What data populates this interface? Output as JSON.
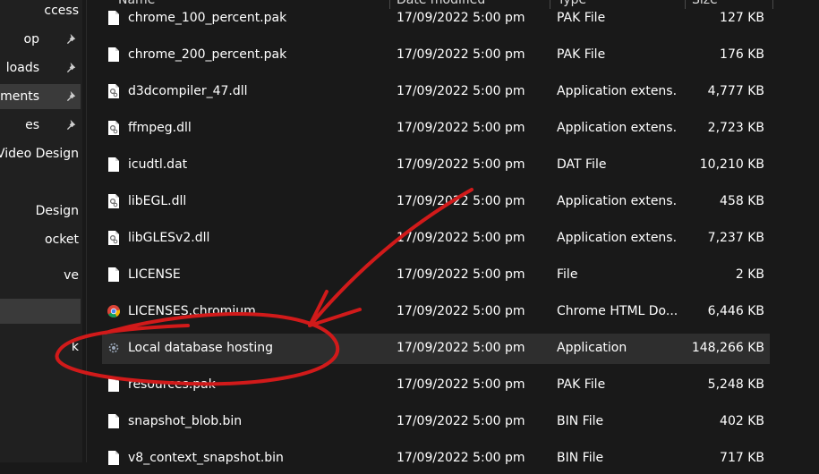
{
  "sidebar": {
    "items": [
      {
        "label": "ccess",
        "pinned": false,
        "selected": false
      },
      {
        "label": "op",
        "pinned": true,
        "selected": false
      },
      {
        "label": "loads",
        "pinned": true,
        "selected": false
      },
      {
        "label": "ments",
        "pinned": true,
        "selected": true
      },
      {
        "label": "es",
        "pinned": true,
        "selected": false
      },
      {
        "label": "Video Design",
        "pinned": false,
        "selected": false
      },
      {
        "label": "Design",
        "pinned": false,
        "selected": false
      },
      {
        "label": "ocket",
        "pinned": false,
        "selected": false
      },
      {
        "label": "ve",
        "pinned": false,
        "selected": false
      },
      {
        "label": "",
        "pinned": false,
        "selected": true
      },
      {
        "label": "k",
        "pinned": false,
        "selected": false
      }
    ]
  },
  "columns": {
    "name": "Name",
    "date": "Date modified",
    "type": "Type",
    "size": "Size"
  },
  "files": [
    {
      "name": "chrome_100_percent.pak",
      "date": "17/09/2022 5:00 pm",
      "type": "PAK File",
      "size": "127 KB",
      "icon": "file-icon"
    },
    {
      "name": "chrome_200_percent.pak",
      "date": "17/09/2022 5:00 pm",
      "type": "PAK File",
      "size": "176 KB",
      "icon": "file-icon"
    },
    {
      "name": "d3dcompiler_47.dll",
      "date": "17/09/2022 5:00 pm",
      "type": "Application extens...",
      "size": "4,777 KB",
      "icon": "dll-icon"
    },
    {
      "name": "ffmpeg.dll",
      "date": "17/09/2022 5:00 pm",
      "type": "Application extens...",
      "size": "2,723 KB",
      "icon": "dll-icon"
    },
    {
      "name": "icudtl.dat",
      "date": "17/09/2022 5:00 pm",
      "type": "DAT File",
      "size": "10,210 KB",
      "icon": "file-icon"
    },
    {
      "name": "libEGL.dll",
      "date": "17/09/2022 5:00 pm",
      "type": "Application extens...",
      "size": "458 KB",
      "icon": "dll-icon"
    },
    {
      "name": "libGLESv2.dll",
      "date": "17/09/2022 5:00 pm",
      "type": "Application extens...",
      "size": "7,237 KB",
      "icon": "dll-icon"
    },
    {
      "name": "LICENSE",
      "date": "17/09/2022 5:00 pm",
      "type": "File",
      "size": "2 KB",
      "icon": "file-icon"
    },
    {
      "name": "LICENSES.chromium",
      "date": "17/09/2022 5:00 pm",
      "type": "Chrome HTML Do...",
      "size": "6,446 KB",
      "icon": "chrome-icon"
    },
    {
      "name": "Local database hosting",
      "date": "17/09/2022 5:00 pm",
      "type": "Application",
      "size": "148,266 KB",
      "icon": "app-gear-icon",
      "selected": true
    },
    {
      "name": "resources.pak",
      "date": "17/09/2022 5:00 pm",
      "type": "PAK File",
      "size": "5,248 KB",
      "icon": "file-icon"
    },
    {
      "name": "snapshot_blob.bin",
      "date": "17/09/2022 5:00 pm",
      "type": "BIN File",
      "size": "402 KB",
      "icon": "file-icon"
    },
    {
      "name": "v8_context_snapshot.bin",
      "date": "17/09/2022 5:00 pm",
      "type": "BIN File",
      "size": "717 KB",
      "icon": "file-icon"
    }
  ],
  "colors": {
    "annotation": "#d11a1a",
    "background": "#191919",
    "selection": "#2e2e2e"
  }
}
